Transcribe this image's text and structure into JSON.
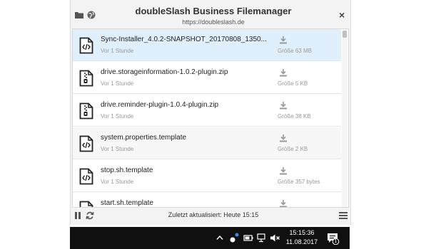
{
  "header": {
    "title": "doubleSlash Business Filemanager",
    "url": "https://doubleslash.de",
    "close_label": "×"
  },
  "files": [
    {
      "name": "Sync-Installer_4.0.2-SNAPSHOT_20170808_1350...",
      "time": "Vor 1 Stunde",
      "size": "Größe 63 MB",
      "icon": "code-file-icon",
      "state": "selected"
    },
    {
      "name": "drive.storageinformation-1.0.2-plugin.zip",
      "time": "Vor 1 Stunde",
      "size": "Größe 5 KB",
      "icon": "zip-file-icon",
      "state": "normal"
    },
    {
      "name": "drive.reminder-plugin-1.0.4-plugin.zip",
      "time": "Vor 1 Stunde",
      "size": "Größe 38 KB",
      "icon": "zip-file-icon",
      "state": "normal"
    },
    {
      "name": "system.properties.template",
      "time": "Vor 1 Stunde",
      "size": "Größe 2 KB",
      "icon": "code-file-icon",
      "state": "hover"
    },
    {
      "name": "stop.sh.template",
      "time": "Vor 1 Stunde",
      "size": "Größe 357 bytes",
      "icon": "code-file-icon",
      "state": "normal"
    },
    {
      "name": "start.sh.template",
      "time": "",
      "size": "",
      "icon": "code-file-icon",
      "state": "normal"
    }
  ],
  "footer": {
    "status": "Zuletzt aktualisiert: Heute 15:15"
  },
  "taskbar": {
    "time": "15:15:36",
    "date": "11.08.2017",
    "notification_count": "1"
  },
  "colors": {
    "selected_row": "#dff0fc",
    "hover_row": "#f7f7f7",
    "taskbar": "#101010",
    "icon_gray": "#999999"
  }
}
